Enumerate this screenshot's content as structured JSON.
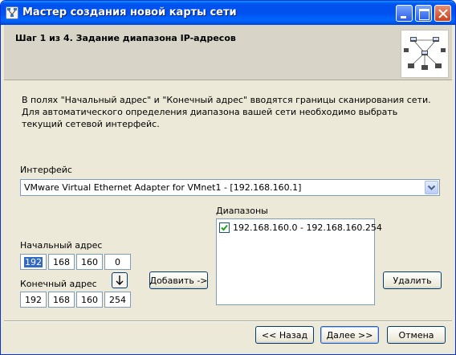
{
  "window": {
    "title": "Мастер создания новой карты сети"
  },
  "header": {
    "step_title": "Шаг 1 из 4. Задание диапазона IP-адресов"
  },
  "description": "В полях \"Начальный адрес\" и \"Конечный адрес\" вводятся границы сканирования сети. Для автоматического определения диапазона вашей сети необходимо выбрать текущий сетевой интерфейс.",
  "interface": {
    "label": "Интерфейс",
    "selected": "VMware Virtual Ethernet Adapter for VMnet1 - [192.168.160.1]"
  },
  "start_address": {
    "label": "Начальный адрес",
    "octets": [
      "192",
      "168",
      "160",
      "0"
    ]
  },
  "end_address": {
    "label": "Конечный адрес",
    "octets": [
      "192",
      "168",
      "160",
      "254"
    ]
  },
  "ranges": {
    "label": "Диапазоны",
    "items": [
      {
        "text": "192.168.160.0 - 192.168.160.254",
        "checked": true
      }
    ]
  },
  "buttons": {
    "add": "Добавить ->",
    "remove": "Удалить",
    "back": "<< Назад",
    "next": "Далее >>",
    "cancel": "Отмена",
    "copy_down": "↓"
  },
  "colors": {
    "title_bar": "#0054e3",
    "window_bg": "#ece9d8",
    "header_bg": "#d8d5c8",
    "selection": "#316ac5",
    "checkmark": "#21a121"
  },
  "icons": {
    "title": "network-map-icon",
    "combo_arrow": "chevron-down-icon",
    "copy_down": "arrow-down-icon",
    "header_image": "network-diagram-image"
  }
}
